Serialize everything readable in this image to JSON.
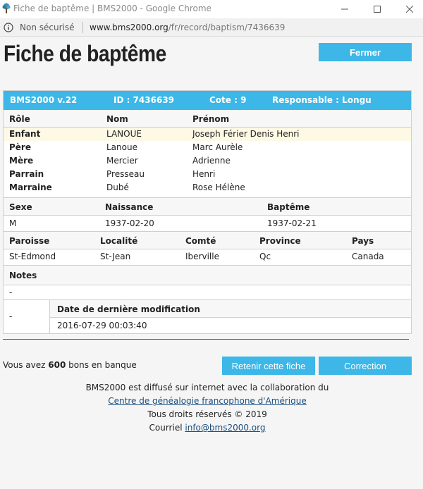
{
  "window": {
    "title": "Fiche de baptême | BMS2000 - Google Chrome"
  },
  "address": {
    "security_label": "Non sécurisé",
    "domain": "www.bms2000.org",
    "path": "/fr/record/baptism/7436639"
  },
  "page": {
    "title": "Fiche de baptême",
    "close_button": "Fermer"
  },
  "record": {
    "header": {
      "version": "BMS2000 v.22",
      "id": "ID : 7436639",
      "cote": "Cote : 9",
      "responsable": "Responsable : Longu"
    },
    "persons_headers": {
      "role": "Rôle",
      "nom": "Nom",
      "prenom": "Prénom"
    },
    "persons": [
      {
        "role": "Enfant",
        "nom": "LANOUE",
        "prenom": "Joseph Férier Denis Henri"
      },
      {
        "role": "Père",
        "nom": "Lanoue",
        "prenom": "Marc Aurèle"
      },
      {
        "role": "Mère",
        "nom": "Mercier",
        "prenom": "Adrienne"
      },
      {
        "role": "Parrain",
        "nom": "Presseau",
        "prenom": "Henri"
      },
      {
        "role": "Marraine",
        "nom": "Dubé",
        "prenom": "Rose Hélène"
      }
    ],
    "birth_headers": {
      "sexe": "Sexe",
      "naissance": "Naissance",
      "bapteme": "Baptême"
    },
    "birth": {
      "sexe": "M",
      "naissance": "1937-02-20",
      "bapteme": "1937-02-21"
    },
    "place_headers": {
      "paroisse": "Paroisse",
      "localite": "Localité",
      "comte": "Comté",
      "province": "Province",
      "pays": "Pays"
    },
    "place": {
      "paroisse": "St-Edmond",
      "localite": "St-Jean",
      "comte": "Iberville",
      "province": "Qc",
      "pays": "Canada"
    },
    "notes_header": "Notes",
    "notes": "-",
    "modif_left": "-",
    "modif_header": "Date de dernière modification",
    "modif_value": "2016-07-29 00:03:40"
  },
  "bank": {
    "prefix": "Vous avez",
    "amount": "600",
    "suffix": "bons en banque"
  },
  "actions": {
    "retain": "Retenir cette fiche",
    "correction": "Correction"
  },
  "footer": {
    "line1": "BMS2000 est diffusé sur internet avec la collaboration du",
    "link": "Centre de généalogie francophone d'Amérique",
    "line3": "Tous droits réservés © 2019",
    "contact_prefix": "Courriel",
    "email": "info@bms2000.org"
  },
  "colors": {
    "accent": "#3cb7e7",
    "highlight_row": "#fdf9e4",
    "link": "#1a4f80"
  }
}
